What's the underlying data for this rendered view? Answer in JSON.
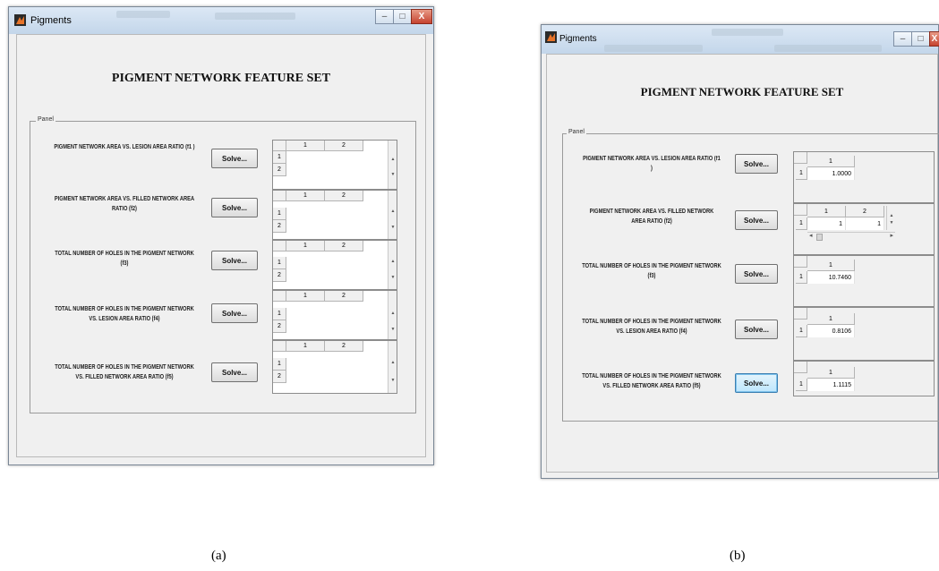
{
  "colors": {
    "title_bar_top": "#dce8f5",
    "title_bar_bottom": "#c3d6ea",
    "client_bg": "#f0f0f0",
    "close_button": "#c64330",
    "focused_button": "#bde6fd"
  },
  "close_symbol": "X",
  "minimize_symbol": "–",
  "maximize_symbol": "□",
  "scroll_up": "▲",
  "scroll_down": "▼",
  "scroll_left": "◂",
  "scroll_right": "▸",
  "window_a": {
    "title": "Pigments",
    "heading": "PIGMENT NETWORK FEATURE SET",
    "panel_label": "Panel",
    "rows": [
      {
        "label": "PIGMENT NETWORK AREA VS. LESION AREA RATIO (f1 )",
        "button": "Solve...",
        "table": {
          "col_headers": [
            "1",
            "2"
          ],
          "row_headers": [
            "1",
            "2"
          ]
        }
      },
      {
        "label": "PIGMENT NETWORK AREA VS. FILLED NETWORK  AREA RATIO (f2)",
        "button": "Solve...",
        "table": {
          "col_headers": [
            "1",
            "2"
          ],
          "row_headers": [
            "1",
            "2"
          ]
        }
      },
      {
        "label": "TOTAL NUMBER OF HOLES IN THE PIGMENT NETWORK (f3)",
        "button": "Solve...",
        "table": {
          "col_headers": [
            "1",
            "2"
          ],
          "row_headers": [
            "1",
            "2"
          ]
        }
      },
      {
        "label": "TOTAL NUMBER OF HOLES IN THE PIGMENT NETWORK VS. LESION AREA RATIO (f4)",
        "button": "Solve...",
        "table": {
          "col_headers": [
            "1",
            "2"
          ],
          "row_headers": [
            "1",
            "2"
          ]
        }
      },
      {
        "label": "TOTAL NUMBER OF HOLES IN THE PIGMENT NETWORK VS. FILLED NETWORK AREA RATIO (f5)",
        "button": "Solve...",
        "table": {
          "col_headers": [
            "1",
            "2"
          ],
          "row_headers": [
            "1",
            "2"
          ]
        }
      }
    ]
  },
  "window_b": {
    "title": "Pigments",
    "heading": "PIGMENT NETWORK FEATURE SET",
    "panel_label": "Panel",
    "rows": [
      {
        "label": "PIGMENT NETWORK AREA VS. LESION AREA RATIO (f1 )",
        "button": "Solve...",
        "table": {
          "col_headers": [
            "1"
          ],
          "row_headers": [
            "1"
          ],
          "values": [
            "1.0000"
          ]
        }
      },
      {
        "label": "PIGMENT NETWORK AREA VS. FILLED NETWORK  AREA RATIO (f2)",
        "button": "Solve...",
        "table": {
          "col_headers": [
            "1",
            "2"
          ],
          "row_headers": [
            "1"
          ],
          "values": [
            "1",
            "1"
          ]
        }
      },
      {
        "label": "TOTAL NUMBER OF HOLES IN THE PIGMENT NETWORK (f3)",
        "button": "Solve...",
        "table": {
          "col_headers": [
            "1"
          ],
          "row_headers": [
            "1"
          ],
          "values": [
            "10.7460"
          ]
        }
      },
      {
        "label": "TOTAL NUMBER OF HOLES IN THE PIGMENT NETWORK VS. LESION AREA RATIO (f4)",
        "button": "Solve...",
        "table": {
          "col_headers": [
            "1"
          ],
          "row_headers": [
            "1"
          ],
          "values": [
            "0.8106"
          ]
        }
      },
      {
        "label": "TOTAL NUMBER OF HOLES IN THE PIGMENT NETWORK VS. FILLED NETWORK AREA RATIO (f5)",
        "button": "Solve...",
        "table": {
          "col_headers": [
            "1"
          ],
          "row_headers": [
            "1"
          ],
          "values": [
            "1.1115"
          ]
        }
      }
    ]
  },
  "captions": {
    "a": "(a)",
    "b": "(b)"
  }
}
